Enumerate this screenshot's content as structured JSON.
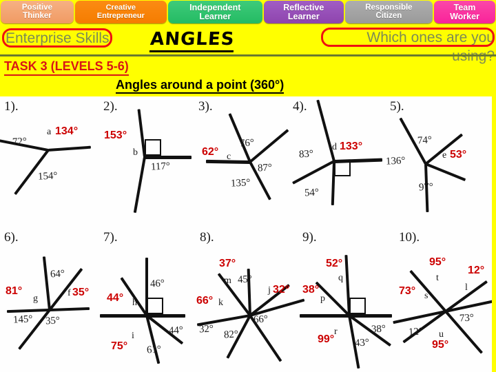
{
  "banner": {
    "skills": [
      {
        "line1": "Positive",
        "line2": "Thinker",
        "color": "#f09a63"
      },
      {
        "line1": "Creative",
        "line2": "Entrepreneur",
        "color": "#f57c00"
      },
      {
        "line1": "Independent",
        "line2": "Learner",
        "color": "#24bb63"
      },
      {
        "line1": "Reflective",
        "line2": "Learner",
        "color": "#8e44ad"
      },
      {
        "line1": "Responsible",
        "line2": "Citizen",
        "color": "#9a9a9a"
      },
      {
        "line1": "Team",
        "line2": "Worker",
        "color": "#f9229a"
      }
    ]
  },
  "header": {
    "enterprise_skills": "Enterprise Skills",
    "title": "ANGLES",
    "which_ones": "Which ones are you using?",
    "task_label": "TASK 3 (LEVELS 5-6)",
    "subtitle": "Angles around a point (360°)",
    "accent_red": "#ee1111",
    "accent_green": "#6b7a2e",
    "background": "#ffff00"
  },
  "worksheet": {
    "figures": [
      {
        "number": "1).",
        "printed": [
          "72°",
          "154°"
        ],
        "letters": [
          "a"
        ],
        "answers": [
          "134°"
        ]
      },
      {
        "number": "2).",
        "printed": [
          "117°"
        ],
        "letters": [
          "b"
        ],
        "answers": [
          "153°"
        ],
        "right_angle": true
      },
      {
        "number": "3).",
        "printed": [
          "76°",
          "87°",
          "135°"
        ],
        "letters": [
          "c"
        ],
        "answers": [
          "62°"
        ]
      },
      {
        "number": "4).",
        "printed": [
          "83°",
          "54°"
        ],
        "letters": [
          "d"
        ],
        "answers": [
          "133°"
        ],
        "right_angle": true
      },
      {
        "number": "5).",
        "printed": [
          "74°",
          "136°",
          "97°"
        ],
        "letters": [
          "e"
        ],
        "answers": [
          "53°"
        ]
      },
      {
        "number": "6).",
        "printed": [
          "64°",
          "35°",
          "145°"
        ],
        "letters": [
          "g",
          "f"
        ],
        "answers": [
          "81°",
          "35°"
        ]
      },
      {
        "number": "7).",
        "printed": [
          "46°",
          "44°",
          "61°"
        ],
        "letters": [
          "h",
          "i"
        ],
        "answers": [
          "44°",
          "75°"
        ],
        "right_angle": true
      },
      {
        "number": "8).",
        "printed": [
          "45°",
          "66°",
          "82°",
          "32°"
        ],
        "letters": [
          "m",
          "j",
          "k"
        ],
        "answers": [
          "37°",
          "32°",
          "66°"
        ]
      },
      {
        "number": "9).",
        "printed": [
          "38°",
          "43°"
        ],
        "letters": [
          "q",
          "p",
          "r"
        ],
        "answers": [
          "52°",
          "38°",
          "99°"
        ],
        "right_angle": true
      },
      {
        "number": "10).",
        "printed": [
          "73°",
          "12°"
        ],
        "letters": [
          "t",
          "l",
          "s",
          "u"
        ],
        "answers": [
          "95°",
          "12°",
          "73°",
          "95°"
        ]
      }
    ]
  }
}
